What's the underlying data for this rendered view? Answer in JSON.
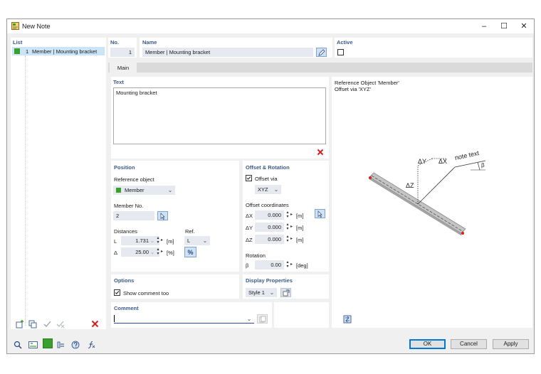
{
  "window": {
    "title": "New Note"
  },
  "list": {
    "label": "List",
    "items": [
      {
        "number": "1",
        "label": "Member | Mounting bracket",
        "color": "#3aa02c"
      }
    ]
  },
  "header": {
    "no_label": "No.",
    "no_value": "1",
    "name_label": "Name",
    "name_value": "Member | Mounting bracket",
    "active_label": "Active"
  },
  "tabs": [
    {
      "label": "Main"
    }
  ],
  "text_section": {
    "label": "Text",
    "value": "Mounting bracket"
  },
  "position": {
    "label": "Position",
    "reference_object_label": "Reference object",
    "reference_object_value": "Member",
    "member_no_label": "Member No.",
    "member_no_value": "2",
    "distances_label": "Distances",
    "ref_label": "Ref.",
    "l_label": "L",
    "l_value": "1.731",
    "l_unit": "[m]",
    "delta_label": "Δ",
    "delta_value": "25.00",
    "delta_unit": "[%]",
    "ref_value": "L",
    "percent_symbol": "%"
  },
  "offset": {
    "label": "Offset & Rotation",
    "offset_via_label": "Offset via",
    "offset_via_value": "XYZ",
    "coords_label": "Offset coordinates",
    "dx_label": "ΔX",
    "dx_value": "0.000",
    "dx_unit": "[m]",
    "dy_label": "ΔY",
    "dy_value": "0.000",
    "dy_unit": "[m]",
    "dz_label": "ΔZ",
    "dz_value": "0.000",
    "dz_unit": "[m]",
    "rotation_label": "Rotation",
    "beta_label": "β",
    "beta_value": "0.00",
    "beta_unit": "[deg]"
  },
  "options": {
    "label": "Options",
    "show_comment_label": "Show comment too"
  },
  "display": {
    "label": "Display Properties",
    "style_value": "Style 1"
  },
  "comment": {
    "label": "Comment",
    "value": ""
  },
  "preview": {
    "line1": "Reference Object 'Member'",
    "line2": "Offset via 'XYZ'",
    "dy": "ΔY",
    "dx": "ΔX",
    "dz": "ΔZ",
    "note_text": "note text",
    "beta": "β"
  },
  "footer": {
    "ok": "OK",
    "cancel": "Cancel",
    "apply": "Apply"
  },
  "colors": {
    "accent": "#3d5a8a",
    "member_green": "#3aa02c",
    "delete_red": "#d42020"
  }
}
